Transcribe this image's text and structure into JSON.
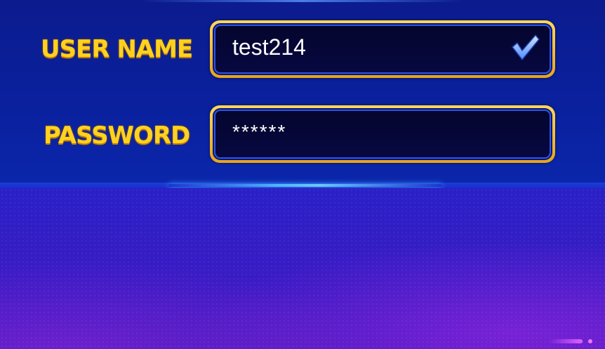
{
  "login": {
    "username_label": "USER NAME",
    "password_label": "PASSWORD",
    "username_value": "test214",
    "password_value": "******",
    "username_status_icon": "checkmark-icon"
  },
  "colors": {
    "label": "#ffd21f",
    "field_frame": "#f0b830",
    "field_background": "#05052e",
    "top_panel": "#0c1c8e",
    "bottom_panel": "#2a20c6"
  }
}
